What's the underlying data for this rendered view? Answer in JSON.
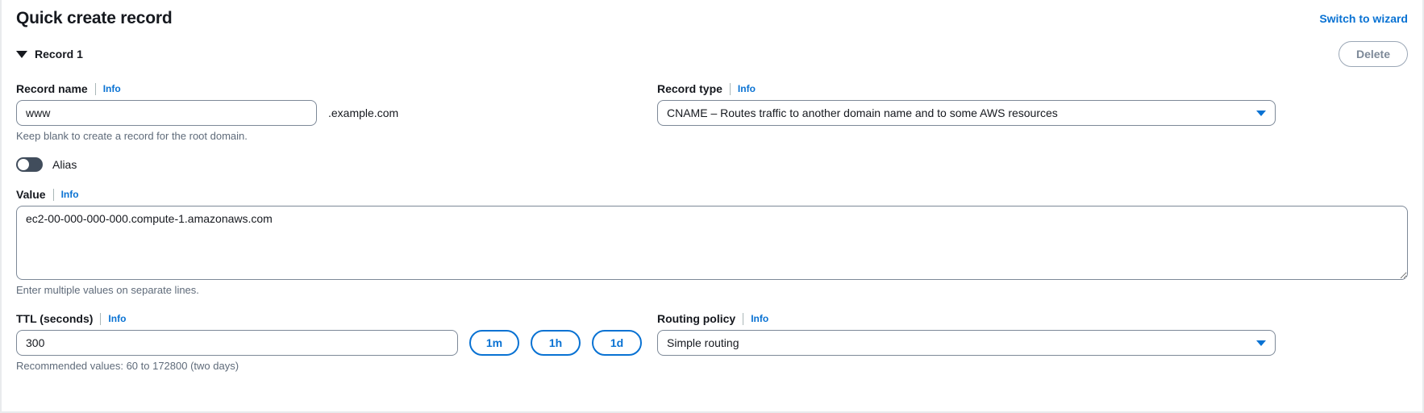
{
  "header": {
    "title": "Quick create record",
    "switch_link": "Switch to wizard"
  },
  "record": {
    "caret_icon": "caret-down-icon",
    "label": "Record 1",
    "delete_label": "Delete"
  },
  "record_name": {
    "label": "Record name",
    "info": "Info",
    "value": "www",
    "placeholder": "",
    "suffix": ".example.com",
    "hint": "Keep blank to create a record for the root domain."
  },
  "record_type": {
    "label": "Record type",
    "info": "Info",
    "value": "CNAME – Routes traffic to another domain name and to some AWS resources",
    "chevron_icon": "chevron-down-icon"
  },
  "alias": {
    "label": "Alias",
    "enabled": false
  },
  "value_field": {
    "label": "Value",
    "info": "Info",
    "value": "ec2-00-000-000-000.compute-1.amazonaws.com",
    "placeholder": "",
    "hint": "Enter multiple values on separate lines."
  },
  "ttl": {
    "label": "TTL (seconds)",
    "info": "Info",
    "value": "300",
    "placeholder": "",
    "hint": "Recommended values: 60 to 172800 (two days)",
    "presets": [
      "1m",
      "1h",
      "1d"
    ]
  },
  "routing_policy": {
    "label": "Routing policy",
    "info": "Info",
    "value": "Simple routing",
    "chevron_icon": "chevron-down-icon"
  },
  "colors": {
    "link": "#0972d3",
    "text": "#16191f",
    "muted": "#5f6b7a",
    "border": "#7d8998",
    "toggle_off": "#414d5c"
  }
}
